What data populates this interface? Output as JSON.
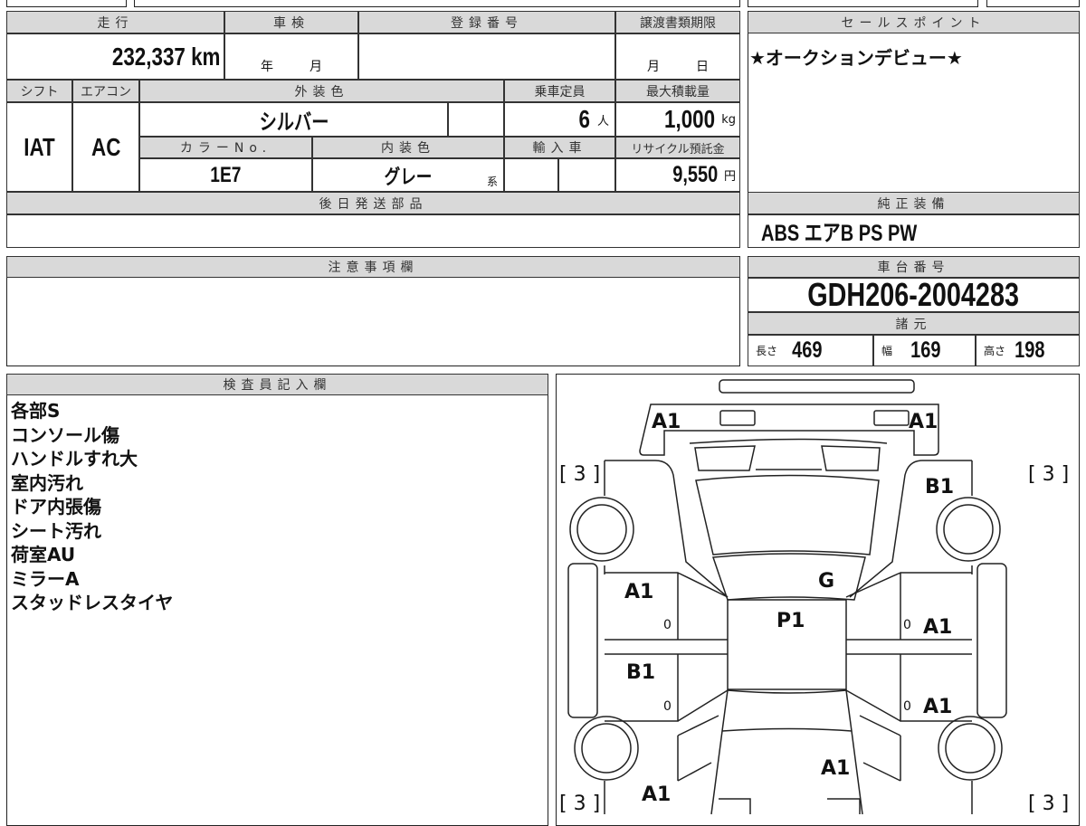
{
  "basic": {
    "mileage_label": "走行",
    "mileage": "232,337",
    "mileage_unit": "km",
    "inspection_label": "車検",
    "year_unit": "年",
    "month_unit": "月",
    "registration_label": "登録番号",
    "transfer_label": "譲渡書類期限",
    "day_unit": "日",
    "shift_label": "シフト",
    "shift": "IAT",
    "ac_label": "エアコン",
    "ac": "AC",
    "exterior_label": "外装色",
    "exterior": "シルバー",
    "capacity_label": "乗車定員",
    "capacity": "6",
    "capacity_unit": "人",
    "load_label": "最大積載量",
    "load": "1,000",
    "load_unit": "kg",
    "color_no_label": "カラーNo.",
    "color_no": "1E7",
    "interior_label": "内装色",
    "interior": "グレー",
    "interior_suffix": "系",
    "import_label": "輸入車",
    "recycle_label": "リサイクル預託金",
    "recycle": "9,550",
    "recycle_unit": "円",
    "later_parts_label": "後日発送部品"
  },
  "sale_point": {
    "label": "セールスポイント",
    "text": "★オークションデビュー★"
  },
  "equipment": {
    "label": "純正装備",
    "text": "ABS エアB PS PW"
  },
  "notes": {
    "label": "注意事項欄"
  },
  "chassis": {
    "label": "車台番号",
    "number": "GDH206-2004283",
    "spec_label": "諸元",
    "length_label": "長さ",
    "length": "469",
    "width_label": "幅",
    "width": "169",
    "height_label": "高さ",
    "height": "198"
  },
  "inspector": {
    "label": "検査員記入欄",
    "lines": [
      "各部S",
      "コンソール傷",
      "ハンドルすれ大",
      "室内汚れ",
      "ドア内張傷",
      "シート汚れ",
      "荷室AU",
      "ミラーA",
      "スタッドレスタイヤ"
    ]
  },
  "diagram": {
    "marks": {
      "front_left": "A1",
      "front_right": "A1",
      "right_fender": "B1",
      "windshield": "G",
      "roof": "P1",
      "left_front_door": "A1",
      "right_front_door": "A1",
      "left_rear_door": "B1",
      "right_rear_door": "A1",
      "rear": "A1",
      "left_rear": "A1"
    },
    "tread": [
      "[ 3 ]",
      "[ 3 ]",
      "[ 3 ]",
      "[ 3 ]"
    ],
    "door_zero": "0"
  }
}
